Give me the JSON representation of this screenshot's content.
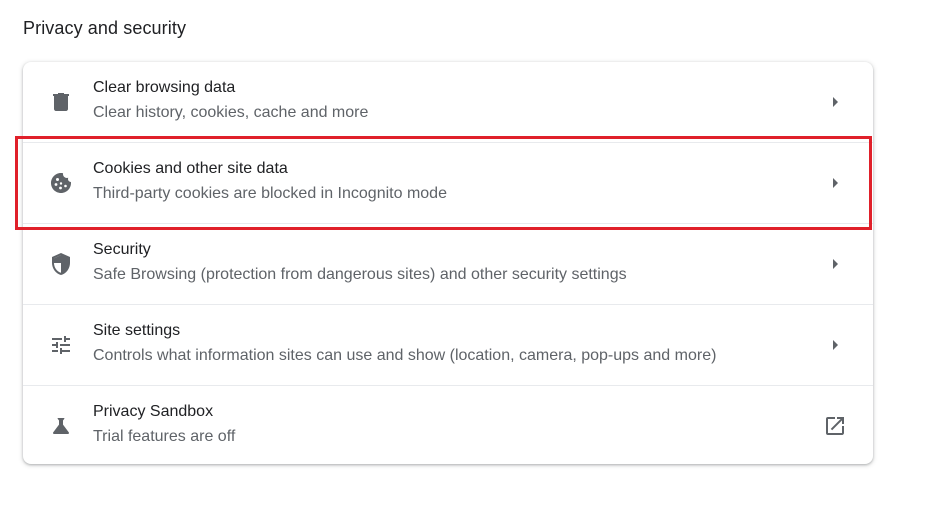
{
  "section": {
    "title": "Privacy and security"
  },
  "rows": [
    {
      "title": "Clear browsing data",
      "subtitle": "Clear history, cookies, cache and more",
      "icon": "trash-icon",
      "action": "chevron-right-icon"
    },
    {
      "title": "Cookies and other site data",
      "subtitle": "Third-party cookies are blocked in Incognito mode",
      "icon": "cookie-icon",
      "action": "chevron-right-icon"
    },
    {
      "title": "Security",
      "subtitle": "Safe Browsing (protection from dangerous sites) and other security settings",
      "icon": "shield-icon",
      "action": "chevron-right-icon"
    },
    {
      "title": "Site settings",
      "subtitle": "Controls what information sites can use and show (location, camera, pop-ups and more)",
      "icon": "tune-sliders-icon",
      "action": "chevron-right-icon"
    },
    {
      "title": "Privacy Sandbox",
      "subtitle": "Trial features are off",
      "icon": "flask-icon",
      "action": "open-in-new-icon"
    }
  ],
  "colors": {
    "title_text": "#202124",
    "secondary_text": "#5f6368",
    "icon": "#5f6368",
    "highlight_border": "#e0202a",
    "divider": "#e8eaed"
  }
}
